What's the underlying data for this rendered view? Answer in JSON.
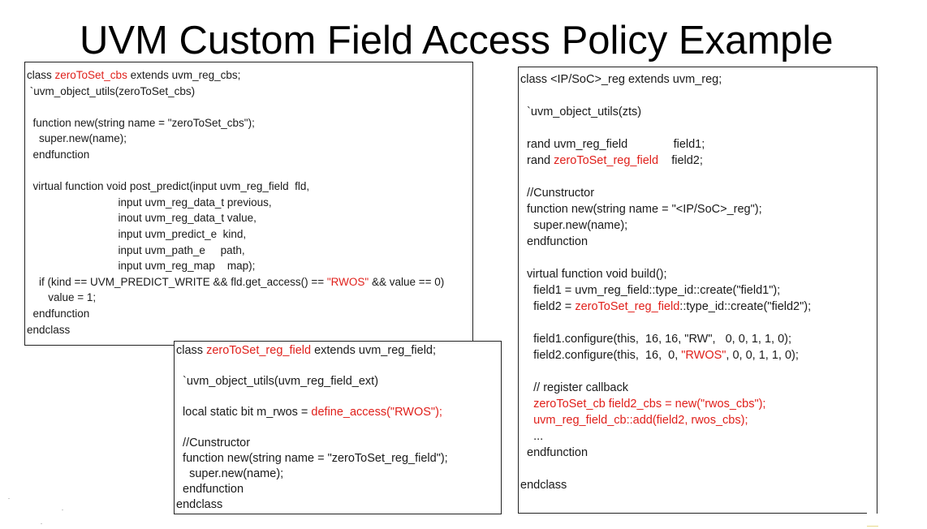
{
  "slide": {
    "title": "UVM Custom Field Access Policy Example"
  },
  "cbs_box": {
    "lines": [
      [
        {
          "t": "class "
        },
        {
          "t": "zeroToSet_cbs",
          "hl": true
        },
        {
          "t": " extends uvm_reg_cbs;"
        }
      ],
      [
        {
          "t": " `uvm_object_utils(zeroToSet_cbs)"
        }
      ],
      [
        {
          "t": ""
        }
      ],
      [
        {
          "t": "  function new(string name = \"zeroToSet_cbs\");"
        }
      ],
      [
        {
          "t": "    super.new(name);"
        }
      ],
      [
        {
          "t": "  endfunction"
        }
      ],
      [
        {
          "t": ""
        }
      ],
      [
        {
          "t": "  virtual function void post_predict(input uvm_reg_field  fld,"
        }
      ],
      [
        {
          "t": "                              input uvm_reg_data_t previous,"
        }
      ],
      [
        {
          "t": "                              inout uvm_reg_data_t value,"
        }
      ],
      [
        {
          "t": "                              input uvm_predict_e  kind,"
        }
      ],
      [
        {
          "t": "                              input uvm_path_e     path,"
        }
      ],
      [
        {
          "t": "                              input uvm_reg_map    map);"
        }
      ],
      [
        {
          "t": "    if (kind == UVM_PREDICT_WRITE && fld.get_access() == "
        },
        {
          "t": "\"RWOS\"",
          "hl": true
        },
        {
          "t": " && value == 0)"
        }
      ],
      [
        {
          "t": "       value = 1;"
        }
      ],
      [
        {
          "t": "  endfunction"
        }
      ],
      [
        {
          "t": "endclass"
        }
      ]
    ]
  },
  "field_box": {
    "lines": [
      [
        {
          "t": "class "
        },
        {
          "t": "zeroToSet_reg_field",
          "hl": true
        },
        {
          "t": " extends uvm_reg_field;"
        }
      ],
      [
        {
          "t": ""
        }
      ],
      [
        {
          "t": "  `uvm_object_utils(uvm_reg_field_ext)"
        }
      ],
      [
        {
          "t": ""
        }
      ],
      [
        {
          "t": "  local static bit m_rwos = "
        },
        {
          "t": "define_access(\"RWOS\");",
          "hl": true
        }
      ],
      [
        {
          "t": ""
        }
      ],
      [
        {
          "t": "  //Cunstructor"
        }
      ],
      [
        {
          "t": "  function new(string name = \"zeroToSet_reg_field\");"
        }
      ],
      [
        {
          "t": "    super.new(name);"
        }
      ],
      [
        {
          "t": "  endfunction"
        }
      ],
      [
        {
          "t": "endclass"
        }
      ]
    ]
  },
  "reg_box": {
    "lines": [
      [
        {
          "t": "class <IP/SoC>_reg extends uvm_reg;"
        }
      ],
      [
        {
          "t": ""
        }
      ],
      [
        {
          "t": "  `uvm_object_utils(zts)"
        }
      ],
      [
        {
          "t": ""
        }
      ],
      [
        {
          "t": "  rand uvm_reg_field              field1;"
        }
      ],
      [
        {
          "t": "  rand "
        },
        {
          "t": "zeroToSet_reg_field",
          "hl": true
        },
        {
          "t": "    field2;"
        }
      ],
      [
        {
          "t": ""
        }
      ],
      [
        {
          "t": "  //Cunstructor"
        }
      ],
      [
        {
          "t": "  function new(string name = \"<IP/SoC>_reg\");"
        }
      ],
      [
        {
          "t": "    super.new(name);"
        }
      ],
      [
        {
          "t": "  endfunction"
        }
      ],
      [
        {
          "t": ""
        }
      ],
      [
        {
          "t": "  virtual function void build();"
        }
      ],
      [
        {
          "t": "    field1 = uvm_reg_field::type_id::create(\"field1\");"
        }
      ],
      [
        {
          "t": "    field2 = "
        },
        {
          "t": "zeroToSet_reg_field",
          "hl": true
        },
        {
          "t": "::type_id::create(\"field2\");"
        }
      ],
      [
        {
          "t": ""
        }
      ],
      [
        {
          "t": "    field1.configure(this,  16, 16, \"RW\",   0, 0, 1, 1, 0);"
        }
      ],
      [
        {
          "t": "    field2.configure(this,  16,  0, "
        },
        {
          "t": "\"RWOS\"",
          "hl": true
        },
        {
          "t": ", 0, 0, 1, 1, 0);"
        }
      ],
      [
        {
          "t": ""
        }
      ],
      [
        {
          "t": "    // register callback"
        }
      ],
      [
        {
          "t": "    zeroToSet_cb field2_cbs = new(\"rwos_cbs\");",
          "hl": true
        }
      ],
      [
        {
          "t": "    uvm_reg_field_cb::add(field2, rwos_cbs);",
          "hl": true
        }
      ],
      [
        {
          "t": "    ..."
        }
      ],
      [
        {
          "t": "  endfunction"
        }
      ],
      [
        {
          "t": ""
        }
      ],
      [
        {
          "t": "endclass"
        }
      ]
    ]
  }
}
